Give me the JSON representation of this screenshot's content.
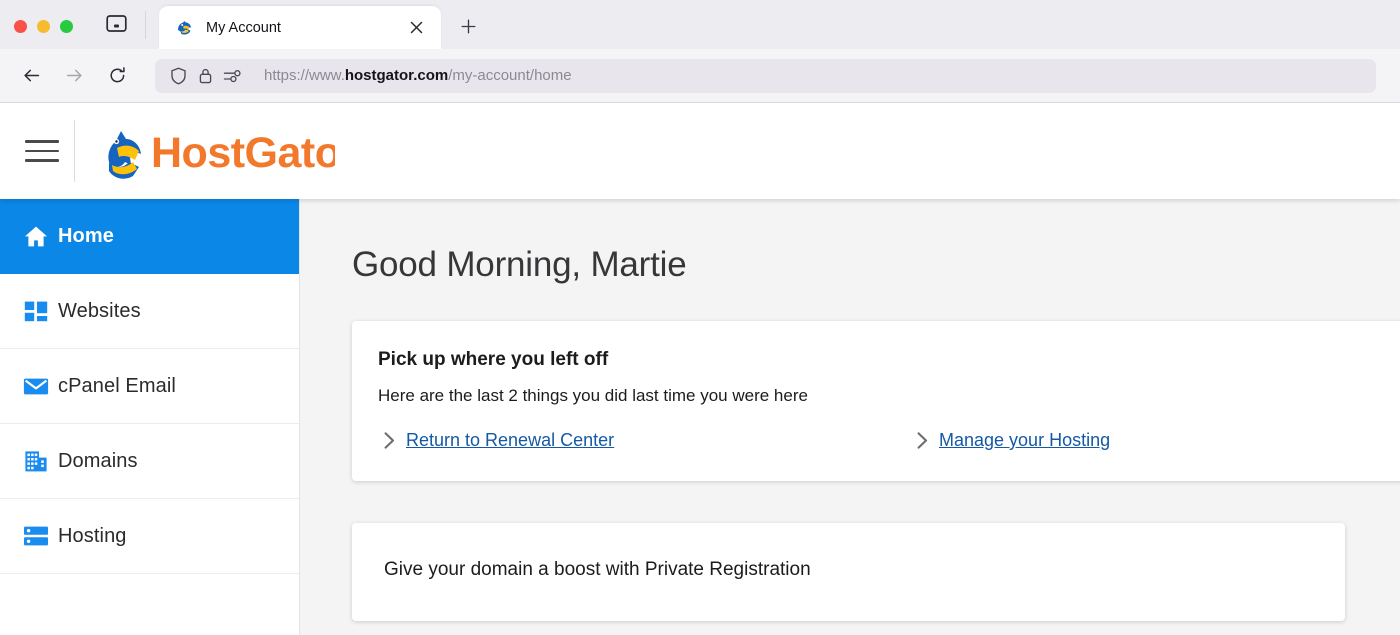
{
  "browser": {
    "tab": {
      "title": "My Account",
      "favicon_name": "hostgator-gator-favicon",
      "close_label": "×"
    },
    "new_tab_label": "+",
    "tab_list_icon": "tab-list-icon",
    "nav": {
      "back_icon": "back-arrow-icon",
      "forward_icon": "forward-arrow-icon",
      "reload_icon": "reload-icon"
    },
    "url": {
      "scheme": "https://www.",
      "host": "hostgator.com",
      "path": "/my-account/home",
      "shield_icon": "shield-icon",
      "lock_icon": "lock-icon",
      "permissions_icon": "permissions-sliders-icon"
    }
  },
  "header": {
    "menu_icon": "hamburger-menu-icon",
    "brand": "HostGator",
    "brand_color": "#f2792c",
    "mascot_icon": "gator-mascot-icon"
  },
  "sidebar": {
    "items": [
      {
        "label": "Home",
        "icon": "home-icon",
        "active": true
      },
      {
        "label": "Websites",
        "icon": "grid-icon",
        "active": false
      },
      {
        "label": "cPanel Email",
        "icon": "envelope-icon",
        "active": false
      },
      {
        "label": "Domains",
        "icon": "building-icon",
        "active": false
      },
      {
        "label": "Hosting",
        "icon": "server-icon",
        "active": false
      }
    ],
    "active_color": "#0b87e8",
    "icon_color": "#1a8cf0"
  },
  "main": {
    "greeting": "Good Morning, Martie",
    "pickup_card": {
      "title": "Pick up where you left off",
      "subtitle": "Here are the last 2 things you did last time you were here",
      "links": [
        {
          "label": "Return to Renewal Center",
          "chevron": "chevron-right-icon"
        },
        {
          "label": "Manage your Hosting",
          "chevron": "chevron-right-icon"
        }
      ],
      "link_color": "#1459a5"
    },
    "promo_card": {
      "title": "Give your domain a boost with Private Registration"
    }
  }
}
